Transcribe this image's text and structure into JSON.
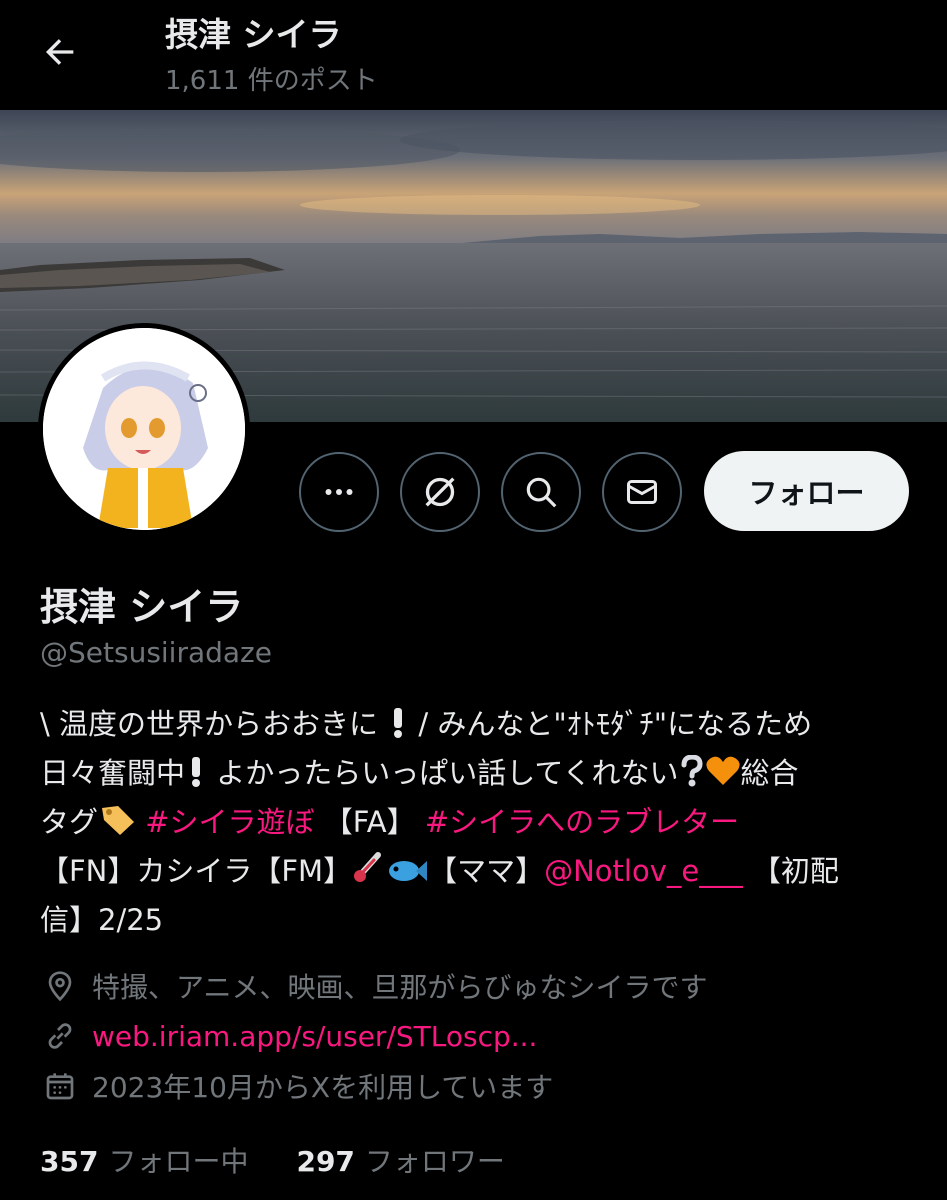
{
  "header": {
    "title": "摂津 シイラ",
    "post_count": "1,611 件のポスト"
  },
  "actions": {
    "follow_label": "フォロー"
  },
  "profile": {
    "display_name": "摂津 シイラ",
    "handle": "@Setsusiiradaze",
    "bio": {
      "line1_a": "\\ 温度の世界からおおきに",
      "line1_b": " / みんなと\"ｵﾄﾓﾀﾞﾁ\"になるため",
      "line2_a": "日々奮闘中",
      "line2_b": " よかったらいっぱい話してくれない",
      "line2_c": "総合",
      "line3_a": "タグ",
      "hashtag1": "#シイラ遊ぼ",
      "line3_b": " 【FA】 ",
      "hashtag2": "#シイラへのラブレター",
      "line4_a": "【FN】カシイラ【FM】",
      "line4_b": "【ママ】",
      "mention": "@Notlov_e___",
      "line4_c": " 【初配",
      "line5": "信】2/25"
    },
    "location": "特撮、アニメ、映画、旦那がらびゅなシイラです",
    "website": "web.iriam.app/s/user/STLoscp...",
    "joined": "2023年10月からXを利用しています"
  },
  "stats": {
    "following_count": "357",
    "following_label": "フォロー中",
    "followers_count": "297",
    "followers_label": "フォロワー"
  },
  "icons": {
    "back": "arrow-left-icon",
    "more": "more-icon",
    "grok": "grok-icon",
    "search": "search-icon",
    "message": "envelope-icon",
    "location": "location-pin-icon",
    "link": "link-icon",
    "calendar": "calendar-icon"
  },
  "colors": {
    "accent": "#f91880",
    "muted": "#71767b",
    "text": "#e7e9ea",
    "follow_bg": "#eff3f4"
  }
}
